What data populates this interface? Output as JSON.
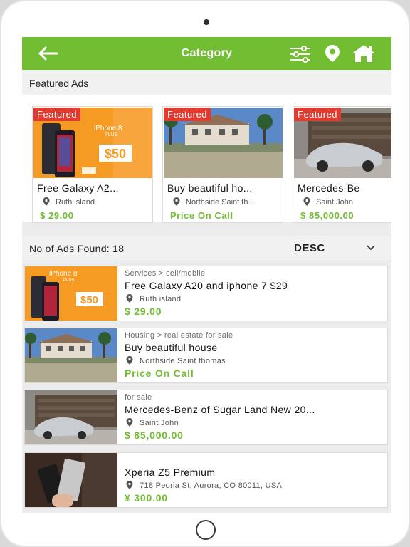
{
  "header": {
    "title": "Category",
    "back_icon": "arrow-left-icon",
    "icons": [
      "filter-sliders-icon",
      "location-pin-icon",
      "home-icon"
    ],
    "bar_color": "#72bd31"
  },
  "featured": {
    "section_title": "Featured Ads",
    "badge_color": "#e33a2f",
    "items": [
      {
        "badge": "Featured",
        "title": "Free Galaxy A2...",
        "location": "Ruth island",
        "price": "$ 29.00"
      },
      {
        "badge": "Featured",
        "title": "Buy beautiful ho...",
        "location": "Northside Saint th...",
        "price": "Price On Call"
      },
      {
        "badge": "Featured",
        "title": "Mercedes-Be",
        "location": "Saint John",
        "price": "$ 85,000.00"
      }
    ]
  },
  "results": {
    "count_text": "No of Ads Found: 18",
    "sort_value": "DESC",
    "price_color": "#72bd31",
    "items": [
      {
        "category": "Services > cell/mobile",
        "title": "Free Galaxy A20 and iphone 7 $29",
        "location": "Ruth island",
        "price": "$ 29.00"
      },
      {
        "category": "Housing > real estate for sale",
        "title": "Buy beautiful house",
        "location": "Northside Saint thomas",
        "price": "Price On Call"
      },
      {
        "category": "for sale",
        "title": "Mercedes-Benz of Sugar Land New 20...",
        "location": "Saint John",
        "price": "$ 85,000.00"
      },
      {
        "category": "",
        "title": "Xperia Z5 Premium",
        "location": "718 Peoria St, Aurora, CO 80011, USA",
        "price": "¥ 300.00"
      }
    ]
  },
  "thumbnails": {
    "phone_ad_text": "iPhone 8",
    "phone_ad_sub": "PLUS",
    "phone_ad_price": "$50"
  }
}
